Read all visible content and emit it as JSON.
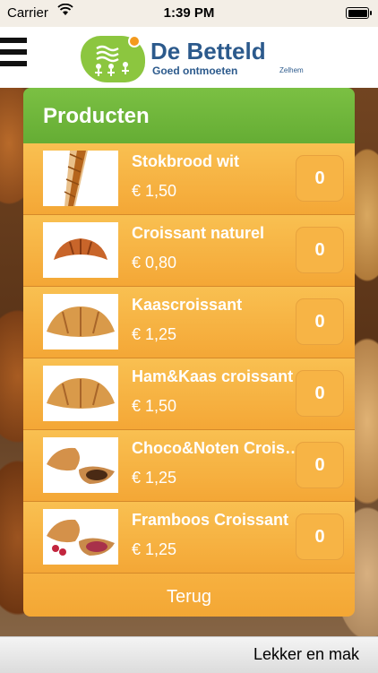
{
  "status": {
    "carrier": "Carrier",
    "time": "1:39 PM"
  },
  "header": {
    "logo_title": "De Betteld",
    "logo_subtitle": "Goed ontmoeten",
    "logo_place": "Zelhem"
  },
  "panel": {
    "title": "Producten",
    "back_label": "Terug"
  },
  "products": [
    {
      "name": "Stokbrood wit",
      "price": "€ 1,50",
      "qty": "0",
      "image": "baguette"
    },
    {
      "name": "Croissant naturel",
      "price": "€ 0,80",
      "qty": "0",
      "image": "croissant"
    },
    {
      "name": "Kaascroissant",
      "price": "€ 1,25",
      "qty": "0",
      "image": "croissant"
    },
    {
      "name": "Ham&Kaas croissant",
      "price": "€ 1,50",
      "qty": "0",
      "image": "croissant"
    },
    {
      "name": "Choco&Noten Croissant",
      "price": "€ 1,25",
      "qty": "0",
      "image": "choco-croissant"
    },
    {
      "name": "Framboos Croissant",
      "price": "€ 1,25",
      "qty": "0",
      "image": "raspberry-croissant"
    }
  ],
  "ticker": {
    "text": "Lekker en mak"
  }
}
